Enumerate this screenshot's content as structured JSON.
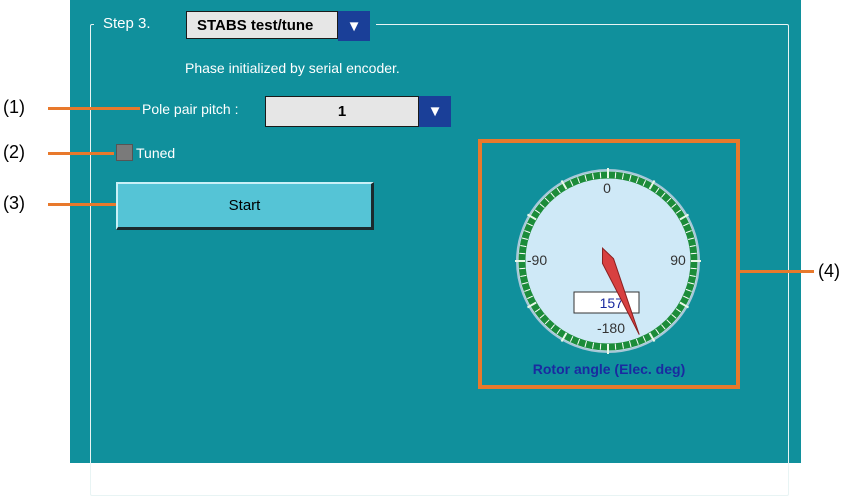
{
  "step": {
    "label": "Step 3.",
    "mode_value": "STABS test/tune"
  },
  "status_text": "Phase initialized by serial encoder.",
  "pole_pair": {
    "label": "Pole pair pitch :",
    "value": "1"
  },
  "tuned": {
    "label": "Tuned",
    "checked": false
  },
  "start_button": {
    "label": "Start"
  },
  "gauge": {
    "title": "Rotor angle (Elec. deg)",
    "ticks": {
      "top": "0",
      "left": "-90",
      "right": "90",
      "bottom": "-180"
    },
    "value_display": "157",
    "needle_angle_deg": 157
  },
  "callouts": {
    "c1": "(1)",
    "c2": "(2)",
    "c3": "(3)",
    "c4": "(4)"
  },
  "colors": {
    "panel": "#10909c",
    "accent_orange": "#e8792c",
    "dropdown_arrow": "#1a3f98",
    "button": "#55c4d6",
    "gauge_ring": "#1c8c3a",
    "gauge_face": "#cfe9f7",
    "needle": "#d84040"
  }
}
